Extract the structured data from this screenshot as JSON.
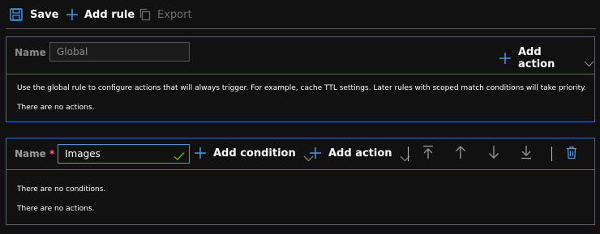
{
  "toolbar": {
    "save_label": "Save",
    "add_rule_label": "Add rule",
    "export_label": "Export"
  },
  "global_rule": {
    "name_label": "Name",
    "name_value": "Global",
    "add_action_label": "Add action",
    "description": "Use the global rule to configure actions that will always trigger. For example, cache TTL settings. Later rules with scoped match conditions will take priority.",
    "no_actions_text": "There are no actions."
  },
  "images_rule": {
    "name_label": "Name",
    "required_marker": "*",
    "name_value": "Images",
    "add_condition_label": "Add condition",
    "add_action_label": "Add action",
    "no_conditions_text": "There are no conditions.",
    "no_actions_text": "There are no actions."
  },
  "colors": {
    "accent": "#3d9bf0",
    "border": "#2b6cc4",
    "valid_check": "#6bb700",
    "required": "#ff6b6b"
  }
}
